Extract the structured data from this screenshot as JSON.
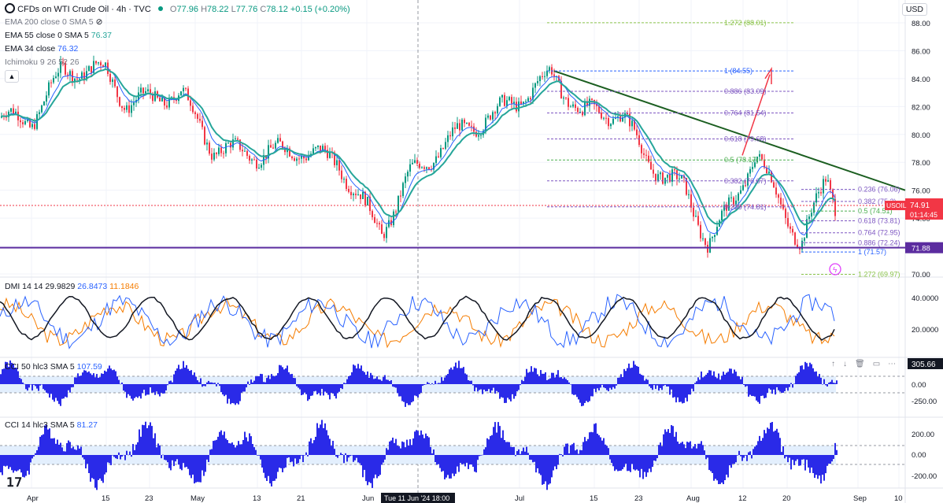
{
  "header": {
    "symbol_title": "CFDs on WTI Crude Oil · 4h · TVC",
    "ohlc": {
      "o_label": "O",
      "o": "77.96",
      "h_label": "H",
      "h": "78.22",
      "l_label": "L",
      "l": "77.76",
      "c_label": "C",
      "c": "78.12",
      "change": "+0.15 (+0.20%)"
    },
    "currency": "USD"
  },
  "indicators": [
    {
      "label": "EMA 200 close 0 SMA 5",
      "value": "",
      "color": "#787b86"
    },
    {
      "label": "EMA 55 close 0 SMA 5",
      "value": "76.37",
      "color": "#26a69a"
    },
    {
      "label": "EMA 34 close",
      "value": "76.32",
      "color": "#2962ff"
    },
    {
      "label": "Ichimoku 9 26 52 26",
      "value": "",
      "color": "#787b86"
    }
  ],
  "price_axis": {
    "ticks": [
      "88.00",
      "86.00",
      "84.00",
      "82.00",
      "80.00",
      "78.00",
      "76.00",
      "74.00",
      "72.00",
      "70.00"
    ],
    "current_price": "74.91",
    "countdown": "01:14:45",
    "symbol_tag": "USOIL",
    "support_price": "71.88",
    "colors": {
      "current": "#f23645",
      "support": "#5b2c9f"
    }
  },
  "fib_upper": [
    {
      "label": "1.272 (88.01)",
      "price": 88.01,
      "color": "#8bc34a"
    },
    {
      "label": "1 (84.55)",
      "price": 84.55,
      "color": "#2962ff"
    },
    {
      "label": "0.886 (83.09)",
      "price": 83.09,
      "color": "#7e57c2"
    },
    {
      "label": "0.764 (81.54)",
      "price": 81.54,
      "color": "#7e57c2"
    },
    {
      "label": "0.618 (79.68)",
      "price": 79.68,
      "color": "#7e57c2"
    },
    {
      "label": "0.5 (78.17)",
      "price": 78.17,
      "color": "#4caf50"
    },
    {
      "label": "0.382 (76.67)",
      "price": 76.67,
      "color": "#7e57c2"
    },
    {
      "label": "0.236 (74.81)",
      "price": 74.81,
      "color": "#7e57c2"
    }
  ],
  "fib_lower": [
    {
      "label": "0.236 (76.06)",
      "price": 76.06,
      "color": "#7e57c2"
    },
    {
      "label": "0.382 (75.2)",
      "price": 75.2,
      "color": "#7e57c2"
    },
    {
      "label": "0.5 (74.51)",
      "price": 74.51,
      "color": "#4caf50"
    },
    {
      "label": "0.618 (73.81)",
      "price": 73.81,
      "color": "#7e57c2"
    },
    {
      "label": "0.764 (72.95)",
      "price": 72.95,
      "color": "#7e57c2"
    },
    {
      "label": "0.886 (72.24)",
      "price": 72.24,
      "color": "#7e57c2"
    },
    {
      "label": "1 (71.57)",
      "price": 71.57,
      "color": "#2962ff"
    },
    {
      "label": "1.272 (69.97)",
      "price": 69.97,
      "color": "#8bc34a"
    }
  ],
  "dmi": {
    "label": "DMI 14 14",
    "values": [
      "29.9829",
      "26.8473",
      "11.1846"
    ],
    "colors": [
      "#131722",
      "#2962ff",
      "#f57c00"
    ],
    "ticks": [
      "40.0000",
      "20.0000"
    ]
  },
  "cci50": {
    "label": "CCI 50 hlc3 SMA 5",
    "value": "107.59",
    "current": "305.66",
    "ticks": [
      "250.00",
      "0.00",
      "-250.00"
    ],
    "color": "#2a2ae8"
  },
  "cci14": {
    "label": "CCI 14 hlc3 SMA 5",
    "value": "81.27",
    "ticks": [
      "200.00",
      "0.00",
      "-200.00"
    ],
    "color": "#2a2ae8"
  },
  "time_axis": {
    "labels": [
      "Apr",
      "15",
      "23",
      "May",
      "13",
      "21",
      "Jun",
      "Jul",
      "15",
      "23",
      "Aug",
      "12",
      "20",
      "Sep",
      "10"
    ],
    "cursor_label": "Tue 11 Jun '24   18:00"
  },
  "chart_data": {
    "type": "line",
    "title": "CFDs on WTI Crude Oil · 4h · TVC",
    "ylabel": "USD",
    "ylim": [
      69,
      89
    ],
    "series": [
      {
        "name": "USOIL",
        "x": [
          "Apr",
          "15",
          "23",
          "May",
          "13",
          "21",
          "Jun",
          "Jul",
          "15",
          "23",
          "Aug",
          "12",
          "20"
        ],
        "values": [
          81.0,
          84.6,
          83.5,
          81.5,
          78.8,
          79.1,
          73.0,
          81.5,
          83.0,
          79.0,
          75.5,
          78.5,
          72.5
        ]
      }
    ],
    "trendline": {
      "from": 84.55,
      "to": 76.0
    },
    "support_level": 71.88,
    "current": 74.91
  }
}
